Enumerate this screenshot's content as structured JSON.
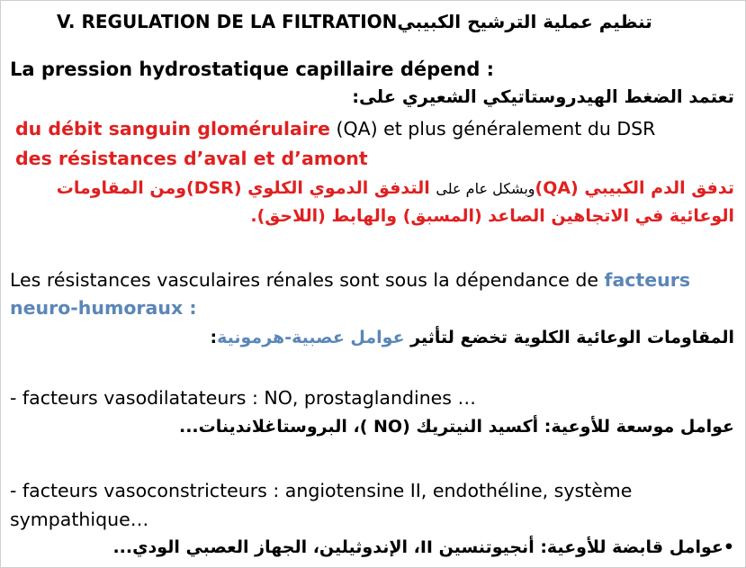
{
  "title": {
    "fr": "V. REGULATION DE LA FILTRATION",
    "ar": "تنظيم عملية الترشيح الكبيبي"
  },
  "section1": {
    "heading_fr": "La pression hydrostatique capillaire dépend :",
    "heading_ar": "تعتمد الضغط الهيدروستاتيكي الشعيري على:",
    "item1_red": "du débit sanguin glomérulaire",
    "item1_rest": " (QA) et plus généralement du DSR",
    "item2_red": "des résistances d’aval et d’amont",
    "ar_line1_red_a": "تدفق الدم الكبيبي (QA)",
    "ar_line1_black": "وبشكل عام على",
    "ar_line1_red_b": "التدفق الدموي الكلوي (DSR)ومن المقاومات",
    "ar_line2_red": "الوعائية في الاتجاهين الصاعد (المسبق) والهابط (اللاحق)."
  },
  "section2": {
    "fr_text": "Les résistances vasculaires rénales sont sous la dépendance de ",
    "fr_blue_1": "facteurs",
    "fr_blue_2": "neuro-humoraux :",
    "ar_text": "المقاومات الوعائية الكلوية تخضع لتأثير ",
    "ar_blue": "عوامل عصبية-هرمونية",
    "ar_end": ":"
  },
  "section3": {
    "fr": "- facteurs vasodilatateurs : NO, prostaglandines …",
    "ar": "عوامل موسعة للأوعية: أكسيد النيتريك (NO )، البروستاغلاندينات..."
  },
  "section4": {
    "fr_line1": "- facteurs vasoconstricteurs : angiotensine II, endothéline, système",
    "fr_line2": "sympathique…",
    "ar": "•عوامل قابضة للأوعية: أنجيوتنسين II، الإندوثيلين، الجهاز العصبي الودي..."
  }
}
